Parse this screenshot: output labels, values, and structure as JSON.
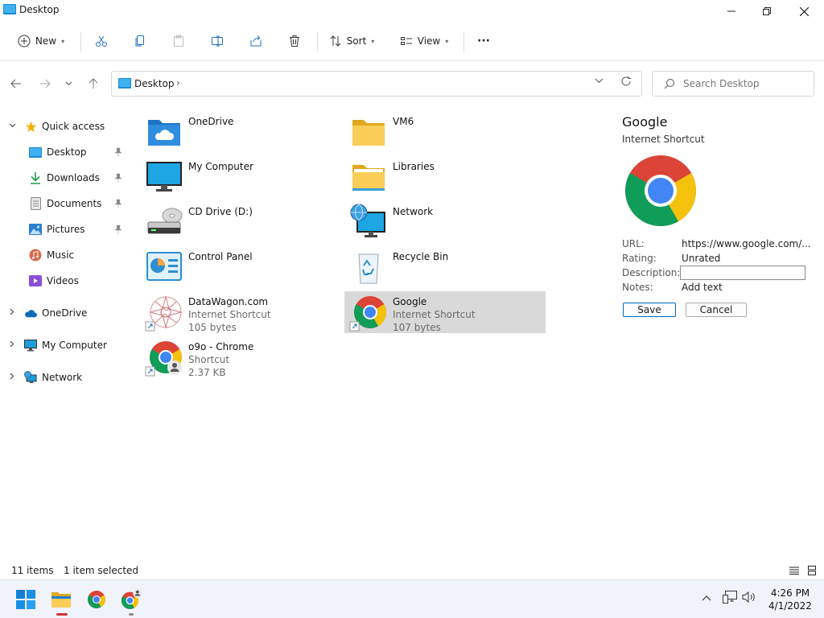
{
  "window": {
    "title": "Desktop"
  },
  "toolbar": {
    "new_label": "New",
    "sort_label": "Sort",
    "view_label": "View",
    "more_label": "···"
  },
  "address": {
    "crumb": "Desktop",
    "separator": "›"
  },
  "search": {
    "placeholder": "Search Desktop"
  },
  "nav": {
    "quick_access": "Quick access",
    "pinned": [
      "Desktop",
      "Downloads",
      "Documents",
      "Pictures"
    ],
    "unpinned": [
      "Music",
      "Videos"
    ],
    "roots": [
      "OneDrive",
      "My Computer",
      "Network"
    ]
  },
  "items": [
    {
      "name": "OneDrive",
      "icon": "onedrive-folder-icon"
    },
    {
      "name": "VM6",
      "icon": "folder-icon"
    },
    {
      "name": "My Computer",
      "icon": "monitor-icon"
    },
    {
      "name": "Libraries",
      "icon": "library-folder-icon"
    },
    {
      "name": "CD Drive (D:)",
      "icon": "cd-drive-icon"
    },
    {
      "name": "Network",
      "icon": "network-globe-icon"
    },
    {
      "name": "Control Panel",
      "icon": "control-panel-icon"
    },
    {
      "name": "Recycle Bin",
      "icon": "recycle-bin-icon"
    },
    {
      "name": "DataWagon.com",
      "type": "Internet Shortcut",
      "size": "105 bytes",
      "icon": "datawagon-shortcut-icon"
    },
    {
      "name": "Google",
      "type": "Internet Shortcut",
      "size": "107 bytes",
      "icon": "chrome-shortcut-icon",
      "selected": true
    },
    {
      "name": "o9o - Chrome",
      "type": "Shortcut",
      "size": "2.37 KB",
      "icon": "chrome-profile-shortcut-icon"
    }
  ],
  "details": {
    "name": "Google",
    "type": "Internet Shortcut",
    "url_label": "URL:",
    "url_value": "https://www.google.com/...",
    "rating_label": "Rating:",
    "rating_value": "Unrated",
    "description_label": "Description:",
    "description_value": "",
    "notes_label": "Notes:",
    "notes_value": "Add text",
    "save_label": "Save",
    "cancel_label": "Cancel"
  },
  "status": {
    "count": "11 items",
    "selection": "1 item selected"
  },
  "taskbar": {
    "time": "4:26 PM",
    "date": "4/1/2022"
  },
  "colors": {
    "accent": "#0067c0",
    "folder": "#f5c242",
    "selected_bg": "#d9d9d9",
    "taskbar_bg": "#f0f3f9",
    "indicator": "#d13438"
  }
}
